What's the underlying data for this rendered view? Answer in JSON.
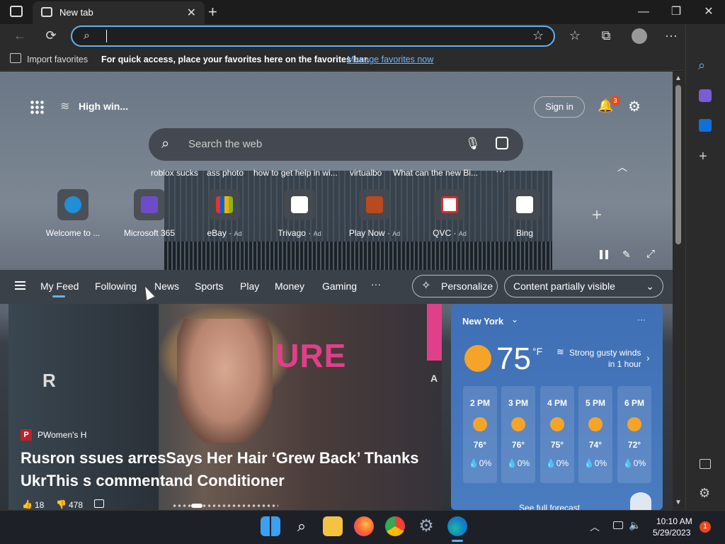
{
  "titlebar": {
    "tab_title": "New tab",
    "new_tab": "+",
    "minimize": "—",
    "maximize": "❐",
    "close": "✕"
  },
  "address": {
    "value": "",
    "placeholder": ""
  },
  "favorites_bar": {
    "import_label": "Import favorites",
    "message": "For quick access, place your favorites here on the favorites bar.",
    "manage_link": "Manage favorites now"
  },
  "header": {
    "weather_label": "High win...",
    "sign_in": "Sign in",
    "notif_count": "3"
  },
  "search": {
    "placeholder": "Search the web"
  },
  "suggestions": [
    "roblox sucks",
    "ass photo",
    "how to get help in wi...",
    "virtualbo",
    "What can the new Bi..."
  ],
  "tiles": [
    {
      "label": "Welcome to ...",
      "ad": "",
      "color": "#1f8fd6"
    },
    {
      "label": "Microsoft 365",
      "ad": "",
      "color": "#6d4cc8"
    },
    {
      "label": "eBay",
      "ad": "Ad",
      "color": "#e5322d"
    },
    {
      "label": "Trivago",
      "ad": "Ad",
      "color": "#ffffff"
    },
    {
      "label": "Play Now",
      "ad": "Ad",
      "color": "#b84a20"
    },
    {
      "label": "QVC",
      "ad": "Ad",
      "color": "#ffffff"
    },
    {
      "label": "Bing",
      "ad": "",
      "color": "#ffffff"
    }
  ],
  "feed_nav": {
    "items": [
      "My Feed",
      "Following",
      "News",
      "Sports",
      "Play",
      "Money",
      "Gaming"
    ],
    "more": "···",
    "personalize": "Personalize",
    "visibility": "Content partially visible"
  },
  "news": {
    "source": "PWomen's H",
    "source_badge": "P",
    "headline_line1": "Rusron ssues arresSays Her Hair ‘Grew Back’ Thanks",
    "headline_line2": "UkrThis s commentand Conditioner",
    "likes": "18",
    "dislikes": "478",
    "bg_text": "CURE",
    "side_letter_left": "R",
    "side_letter_right": "A"
  },
  "weather": {
    "city": "New York",
    "temp": "75",
    "unit": "°F",
    "alert_line1": "Strong gusty winds",
    "alert_line2": "in 1 hour",
    "hours": [
      {
        "time": "2 PM",
        "temp": "76°",
        "precip": "0%"
      },
      {
        "time": "3 PM",
        "temp": "76°",
        "precip": "0%"
      },
      {
        "time": "4 PM",
        "temp": "75°",
        "precip": "0%"
      },
      {
        "time": "5 PM",
        "temp": "74°",
        "precip": "0%"
      },
      {
        "time": "6 PM",
        "temp": "72°",
        "precip": "0%"
      }
    ],
    "forecast_link": "See full forecast"
  },
  "taskbar": {
    "time": "10:10 AM",
    "date": "5/29/2023",
    "notif": "1"
  },
  "colors": {
    "accent": "#5fb2f2",
    "link": "#6cb8ff",
    "badge": "#e8491d"
  }
}
